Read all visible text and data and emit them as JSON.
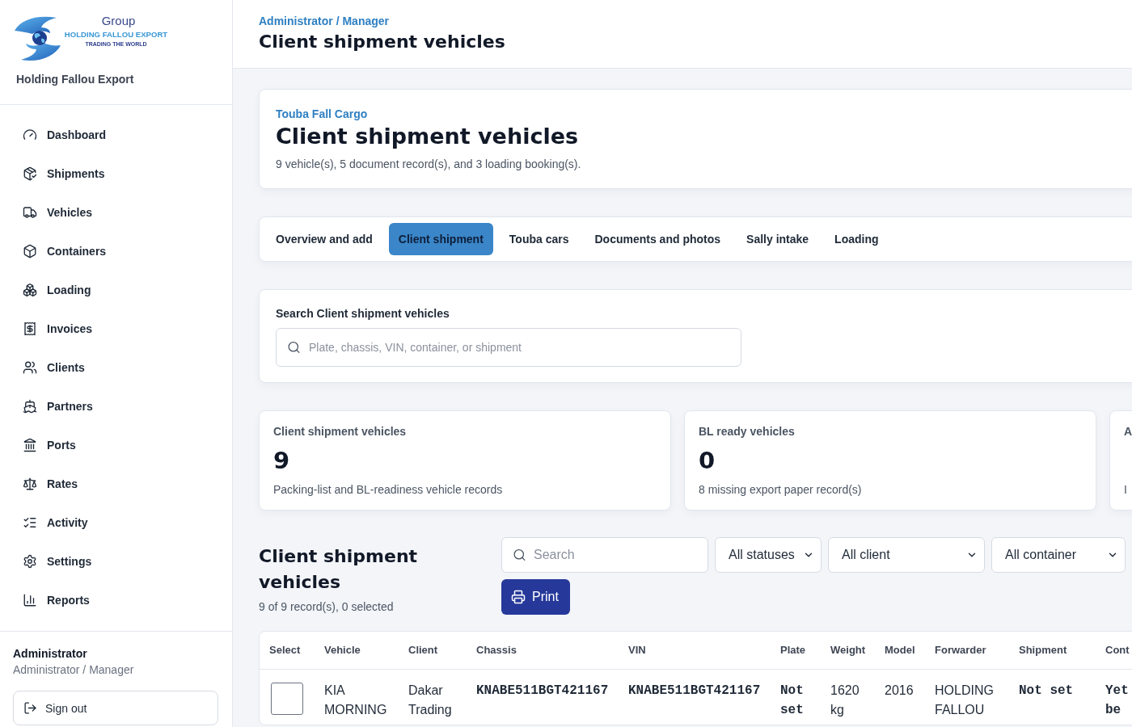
{
  "sidebar": {
    "logo": {
      "word": "Group",
      "name": "HOLDING FALLOU EXPORT",
      "tagline": "TRADING THE WORLD"
    },
    "company": "Holding Fallou Export",
    "nav": [
      {
        "label": "Dashboard",
        "selected": false
      },
      {
        "label": "Shipments",
        "selected": false
      },
      {
        "label": "Vehicles",
        "selected": false
      },
      {
        "label": "Containers",
        "selected": false
      },
      {
        "label": "Loading",
        "selected": false
      },
      {
        "label": "Invoices",
        "selected": false
      },
      {
        "label": "Clients",
        "selected": false
      },
      {
        "label": "Partners",
        "selected": false
      },
      {
        "label": "Ports",
        "selected": false
      },
      {
        "label": "Rates",
        "selected": false
      },
      {
        "label": "Activity",
        "selected": false
      },
      {
        "label": "Settings",
        "selected": false
      },
      {
        "label": "Reports",
        "selected": false
      }
    ],
    "user": {
      "name": "Administrator",
      "role": "Administrator / Manager"
    },
    "sign_out": "Sign out"
  },
  "header": {
    "breadcrumb": "Administrator / Manager",
    "title": "Client shipment vehicles"
  },
  "hero": {
    "eyebrow": "Touba Fall Cargo",
    "title": "Client shipment vehicles",
    "summary": "9 vehicle(s), 5 document record(s), and 3 loading booking(s)."
  },
  "tabs": [
    {
      "label": "Overview and add",
      "selected": false
    },
    {
      "label": "Client shipment",
      "selected": true
    },
    {
      "label": "Touba cars",
      "selected": false
    },
    {
      "label": "Documents and photos",
      "selected": false
    },
    {
      "label": "Sally intake",
      "selected": false
    },
    {
      "label": "Loading",
      "selected": false
    }
  ],
  "search_panel": {
    "label": "Search Client shipment vehicles",
    "placeholder": "Plate, chassis, VIN, container, or shipment"
  },
  "stats": [
    {
      "label": "Client shipment vehicles",
      "value": "9",
      "note": "Packing-list and BL-readiness vehicle records"
    },
    {
      "label": "BL ready vehicles",
      "value": "0",
      "note": "8 missing export paper record(s)"
    },
    {
      "label": "A",
      "note": "I"
    }
  ],
  "list": {
    "title": "Client shipment vehicles",
    "summary": "9 of 9 record(s), 0 selected",
    "search": {
      "placeholder": "Search"
    },
    "filters": [
      "All statuses",
      "All client",
      "All container"
    ],
    "print": "Print"
  },
  "table": {
    "columns": [
      {
        "label": "Select",
        "kind": "check"
      },
      {
        "label": "Vehicle",
        "kind": "text"
      },
      {
        "label": "Client",
        "kind": "text"
      },
      {
        "label": "Chassis",
        "kind": "code"
      },
      {
        "label": "VIN",
        "kind": "code"
      },
      {
        "label": "Plate",
        "kind": "code"
      },
      {
        "label": "Weight",
        "kind": "text"
      },
      {
        "label": "Model",
        "kind": "text"
      },
      {
        "label": "Forwarder",
        "kind": "text"
      },
      {
        "label": "Shipment",
        "kind": "code"
      },
      {
        "label": "Cont",
        "kind": "code"
      }
    ],
    "rows": [
      {
        "selected": false,
        "cells": [
          "",
          "KIA MORNING",
          "Dakar Trading",
          "KNABE511BGT421167",
          "KNABE511BGT421167",
          "Not set",
          "1620 kg",
          "2016",
          "HOLDING FALLOU",
          "Not set",
          "Yet be"
        ]
      }
    ]
  }
}
